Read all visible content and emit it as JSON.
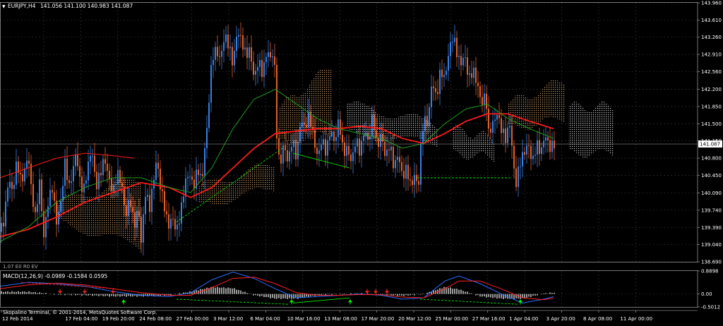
{
  "header": {
    "symbol": "EURJPY,H4",
    "ohlc": "141.056 141.100 140.983 141.087"
  },
  "colors": {
    "background": "#000000",
    "grid": "#3a3a3a",
    "axis": "#c0c0c0",
    "bull": "#3b7fe0",
    "bear": "#e0602a",
    "ma_fast": "#1e9e1e",
    "ma_slow": "#ff1a1a",
    "cloud_a": "#e8b07a",
    "cloud_b": "#e6e6e6",
    "macd_line": "#2a6fff",
    "signal_line": "#ff2020",
    "histogram": "#ffffff",
    "div_up": "#00ff00",
    "div_down": "#ff2020",
    "price_tag": "#ffffff"
  },
  "main_panel": {
    "corner_label": "1.07 E0 R0 EV",
    "price_tag": "141.087"
  },
  "macd_panel": {
    "label": "MACD(12,26,9) -0.0989 -0.1584 0.0595",
    "ticks": [
      "0.8898",
      "0.00",
      "-0.5012"
    ]
  },
  "footer": {
    "copyright": "Skopalino Terminal, © 2001-2014, MetaQuotes Software Corp."
  },
  "chart_data": {
    "type": "candlestick",
    "symbol": "EURJPY",
    "timeframe": "H4",
    "ylim": [
      138.69,
      143.96
    ],
    "y_ticks": [
      "143.960",
      "143.610",
      "143.260",
      "142.910",
      "142.560",
      "142.200",
      "141.850",
      "141.500",
      "141.150",
      "140.800",
      "140.450",
      "140.090",
      "139.740",
      "139.390",
      "139.040",
      "138.690"
    ],
    "x_ticks": [
      "12 Feb 2014",
      "17 Feb 04:00",
      "19 Feb 20:00",
      "24 Feb 08:00",
      "27 Feb 00:00",
      "3 Mar 12:00",
      "6 Mar 04:00",
      "10 Mar 16:00",
      "13 Mar 08:00",
      "17 Mar 20:00",
      "20 Mar 12:00",
      "25 Mar 00:00",
      "27 Mar 16:00",
      "1 Apr 04:00",
      "3 Apr 20:00",
      "8 Apr 08:00",
      "11 Apr 00:00"
    ],
    "last_price": 141.087,
    "close_path": [
      [
        0,
        139.3
      ],
      [
        6,
        139.55
      ],
      [
        12,
        140.4
      ],
      [
        18,
        140.1
      ],
      [
        24,
        140.75
      ],
      [
        30,
        140.3
      ],
      [
        36,
        140.6
      ],
      [
        40,
        140.9
      ],
      [
        44,
        140.2
      ],
      [
        50,
        139.6
      ],
      [
        56,
        140.3
      ],
      [
        62,
        139.2
      ],
      [
        68,
        139.9
      ],
      [
        74,
        140.2
      ],
      [
        80,
        139.5
      ],
      [
        86,
        139.9
      ],
      [
        92,
        140.7
      ],
      [
        98,
        140.2
      ],
      [
        104,
        140.6
      ],
      [
        108,
        140.95
      ],
      [
        112,
        140.4
      ],
      [
        118,
        140.1
      ],
      [
        124,
        140.6
      ],
      [
        130,
        141.0
      ],
      [
        136,
        140.2
      ],
      [
        142,
        140.5
      ],
      [
        148,
        140.8
      ],
      [
        154,
        140.4
      ],
      [
        160,
        140.1
      ],
      [
        166,
        140.5
      ],
      [
        172,
        140.3
      ],
      [
        178,
        139.6
      ],
      [
        184,
        140.0
      ],
      [
        190,
        139.4
      ],
      [
        196,
        139.8
      ],
      [
        200,
        139.1
      ],
      [
        206,
        140.1
      ],
      [
        212,
        139.8
      ],
      [
        218,
        140.4
      ],
      [
        222,
        140.8
      ],
      [
        226,
        140.3
      ],
      [
        232,
        139.9
      ],
      [
        238,
        139.4
      ],
      [
        244,
        139.6
      ],
      [
        250,
        139.3
      ],
      [
        256,
        139.7
      ],
      [
        262,
        140.3
      ],
      [
        268,
        140.5
      ],
      [
        274,
        140.2
      ],
      [
        280,
        140.6
      ],
      [
        286,
        140.3
      ],
      [
        290,
        141.0
      ],
      [
        294,
        141.5
      ],
      [
        298,
        142.5
      ],
      [
        302,
        142.9
      ],
      [
        306,
        143.0
      ],
      [
        312,
        142.8
      ],
      [
        318,
        143.3
      ],
      [
        324,
        143.1
      ],
      [
        330,
        142.7
      ],
      [
        336,
        143.4
      ],
      [
        342,
        143.2
      ],
      [
        348,
        142.9
      ],
      [
        354,
        143.0
      ],
      [
        360,
        142.4
      ],
      [
        366,
        142.8
      ],
      [
        372,
        142.5
      ],
      [
        378,
        143.0
      ],
      [
        384,
        142.8
      ],
      [
        388,
        143.05
      ],
      [
        392,
        141.3
      ],
      [
        396,
        140.6
      ],
      [
        402,
        141.1
      ],
      [
        408,
        140.7
      ],
      [
        414,
        141.2
      ],
      [
        420,
        140.8
      ],
      [
        426,
        141.6
      ],
      [
        432,
        141.4
      ],
      [
        438,
        141.7
      ],
      [
        444,
        141.2
      ],
      [
        450,
        140.8
      ],
      [
        456,
        141.2
      ],
      [
        462,
        140.9
      ],
      [
        468,
        141.4
      ],
      [
        474,
        141.1
      ],
      [
        480,
        141.6
      ],
      [
        486,
        140.9
      ],
      [
        492,
        141.0
      ],
      [
        498,
        140.7
      ],
      [
        504,
        141.2
      ],
      [
        510,
        140.9
      ],
      [
        516,
        141.4
      ],
      [
        522,
        141.1
      ],
      [
        528,
        141.7
      ],
      [
        534,
        141.0
      ],
      [
        540,
        141.3
      ],
      [
        546,
        140.8
      ],
      [
        552,
        141.1
      ],
      [
        558,
        140.6
      ],
      [
        564,
        140.9
      ],
      [
        570,
        140.4
      ],
      [
        576,
        140.6
      ],
      [
        582,
        140.2
      ],
      [
        588,
        140.5
      ],
      [
        592,
        140.1
      ],
      [
        596,
        141.0
      ],
      [
        600,
        141.6
      ],
      [
        606,
        141.5
      ],
      [
        612,
        142.4
      ],
      [
        618,
        142.0
      ],
      [
        624,
        142.6
      ],
      [
        630,
        142.4
      ],
      [
        636,
        143.0
      ],
      [
        642,
        143.3
      ],
      [
        646,
        143.0
      ],
      [
        652,
        142.7
      ],
      [
        658,
        142.9
      ],
      [
        664,
        142.4
      ],
      [
        670,
        142.6
      ],
      [
        676,
        142.3
      ],
      [
        682,
        141.9
      ],
      [
        688,
        142.1
      ],
      [
        692,
        141.3
      ],
      [
        698,
        141.5
      ],
      [
        704,
        141.7
      ],
      [
        710,
        141.4
      ],
      [
        716,
        141.2
      ],
      [
        722,
        141.5
      ],
      [
        726,
        140.9
      ],
      [
        730,
        140.2
      ],
      [
        736,
        140.7
      ],
      [
        742,
        140.9
      ],
      [
        748,
        141.1
      ],
      [
        754,
        140.7
      ],
      [
        760,
        141.1
      ],
      [
        766,
        140.9
      ],
      [
        772,
        141.3
      ],
      [
        778,
        141.0
      ],
      [
        784,
        141.087
      ]
    ],
    "ma_fast": [
      [
        0,
        139.1
      ],
      [
        40,
        139.4
      ],
      [
        80,
        139.9
      ],
      [
        120,
        140.2
      ],
      [
        160,
        140.4
      ],
      [
        200,
        140.4
      ],
      [
        240,
        140.2
      ],
      [
        270,
        140.1
      ],
      [
        300,
        140.6
      ],
      [
        330,
        141.4
      ],
      [
        360,
        142.0
      ],
      [
        390,
        142.2
      ],
      [
        420,
        141.9
      ],
      [
        450,
        141.6
      ],
      [
        480,
        141.4
      ],
      [
        510,
        141.3
      ],
      [
        540,
        141.2
      ],
      [
        570,
        141.0
      ],
      [
        600,
        141.1
      ],
      [
        630,
        141.5
      ],
      [
        660,
        141.8
      ],
      [
        690,
        141.9
      ],
      [
        720,
        141.6
      ],
      [
        750,
        141.4
      ],
      [
        784,
        141.2
      ]
    ],
    "ma_slow": [
      [
        0,
        139.2
      ],
      [
        40,
        139.35
      ],
      [
        80,
        139.6
      ],
      [
        120,
        139.9
      ],
      [
        160,
        140.1
      ],
      [
        200,
        140.3
      ],
      [
        240,
        140.2
      ],
      [
        270,
        140.0
      ],
      [
        300,
        140.2
      ],
      [
        330,
        140.6
      ],
      [
        360,
        141.0
      ],
      [
        390,
        141.3
      ],
      [
        420,
        141.35
      ],
      [
        450,
        141.4
      ],
      [
        480,
        141.4
      ],
      [
        510,
        141.45
      ],
      [
        540,
        141.4
      ],
      [
        570,
        141.2
      ],
      [
        600,
        141.1
      ],
      [
        630,
        141.3
      ],
      [
        660,
        141.55
      ],
      [
        690,
        141.7
      ],
      [
        720,
        141.7
      ],
      [
        750,
        141.55
      ],
      [
        784,
        141.4
      ]
    ],
    "ma_long": [
      [
        0,
        140.4
      ],
      [
        40,
        140.6
      ],
      [
        80,
        140.8
      ],
      [
        120,
        140.9
      ],
      [
        160,
        140.85
      ],
      [
        190,
        140.8
      ]
    ],
    "cloud_a": [
      {
        "x": [
          80,
          200
        ],
        "top": [
          139.9,
          140.4
        ],
        "bot": [
          139.5,
          139.0
        ]
      },
      {
        "x": [
          280,
          390
        ],
        "top": [
          140.2,
          140.7
        ],
        "bot": [
          139.8,
          140.2
        ]
      },
      {
        "x": [
          395,
          470
        ],
        "top": [
          141.8,
          142.7
        ],
        "bot": [
          141.1,
          141.3
        ]
      },
      {
        "x": [
          720,
          800
        ],
        "top": [
          141.9,
          142.4
        ],
        "bot": [
          141.4,
          141.6
        ]
      }
    ],
    "cloud_b": [
      {
        "x": [
          490,
          620
        ],
        "top": [
          141.9,
          141.5
        ],
        "bot": [
          141.3,
          141.1
        ]
      },
      {
        "x": [
          640,
          700
        ],
        "top": [
          141.4,
          141.2
        ],
        "bot": [
          140.9,
          140.8
        ]
      },
      {
        "x": [
          805,
          870
        ],
        "top": [
          141.85,
          141.85
        ],
        "bot": [
          140.9,
          140.9
        ]
      }
    ],
    "divergence_lines": [
      {
        "color": "up",
        "from": [
          250,
          139.5
        ],
        "to": [
          400,
          141.0
        ],
        "dashed": true
      },
      {
        "color": "up",
        "from": [
          415,
          140.9
        ],
        "to": [
          495,
          140.6
        ],
        "dashed": false
      },
      {
        "color": "up",
        "from": [
          590,
          140.4
        ],
        "to": [
          725,
          140.4
        ],
        "dashed": true
      }
    ],
    "macd": {
      "ylim": [
        -0.5012,
        0.8898
      ],
      "zero": 0.0,
      "macd_line": [
        [
          0,
          0.3
        ],
        [
          40,
          0.45
        ],
        [
          80,
          0.4
        ],
        [
          120,
          0.3
        ],
        [
          160,
          0.1
        ],
        [
          200,
          -0.05
        ],
        [
          240,
          -0.1
        ],
        [
          270,
          0.05
        ],
        [
          300,
          0.55
        ],
        [
          330,
          0.85
        ],
        [
          360,
          0.6
        ],
        [
          390,
          0.2
        ],
        [
          420,
          -0.15
        ],
        [
          450,
          -0.1
        ],
        [
          480,
          -0.05
        ],
        [
          510,
          0.0
        ],
        [
          540,
          -0.05
        ],
        [
          570,
          -0.2
        ],
        [
          600,
          -0.15
        ],
        [
          630,
          0.5
        ],
        [
          650,
          0.7
        ],
        [
          680,
          0.4
        ],
        [
          710,
          0.0
        ],
        [
          740,
          -0.35
        ],
        [
          770,
          -0.2
        ],
        [
          784,
          -0.1
        ]
      ],
      "signal_line": [
        [
          0,
          0.2
        ],
        [
          40,
          0.35
        ],
        [
          80,
          0.42
        ],
        [
          120,
          0.35
        ],
        [
          160,
          0.2
        ],
        [
          200,
          0.05
        ],
        [
          240,
          -0.05
        ],
        [
          270,
          -0.05
        ],
        [
          300,
          0.25
        ],
        [
          330,
          0.6
        ],
        [
          360,
          0.65
        ],
        [
          390,
          0.4
        ],
        [
          420,
          0.05
        ],
        [
          450,
          -0.05
        ],
        [
          480,
          -0.05
        ],
        [
          510,
          -0.02
        ],
        [
          540,
          -0.03
        ],
        [
          570,
          -0.12
        ],
        [
          600,
          -0.15
        ],
        [
          630,
          0.2
        ],
        [
          650,
          0.5
        ],
        [
          680,
          0.5
        ],
        [
          710,
          0.2
        ],
        [
          740,
          -0.15
        ],
        [
          770,
          -0.22
        ],
        [
          784,
          -0.16
        ]
      ],
      "divergence": [
        {
          "color": "down",
          "from": [
            30,
            0.45
          ],
          "to": [
            165,
            0.2
          ],
          "dashed": true
        },
        {
          "color": "up",
          "from": [
            250,
            -0.2
          ],
          "to": [
            410,
            -0.4
          ],
          "dashed": true
        },
        {
          "color": "up",
          "from": [
            415,
            -0.35
          ],
          "to": [
            495,
            -0.15
          ],
          "dashed": false
        },
        {
          "color": "up",
          "from": [
            595,
            -0.2
          ],
          "to": [
            735,
            -0.4
          ],
          "dashed": true
        }
      ],
      "arrows": [
        {
          "x": 85,
          "dir": "down",
          "color": "down"
        },
        {
          "x": 120,
          "dir": "down",
          "color": "down"
        },
        {
          "x": 160,
          "dir": "down",
          "color": "down"
        },
        {
          "x": 175,
          "dir": "up",
          "color": "up"
        },
        {
          "x": 413,
          "dir": "up",
          "color": "up"
        },
        {
          "x": 496,
          "dir": "up",
          "color": "up"
        },
        {
          "x": 520,
          "dir": "down",
          "color": "down"
        },
        {
          "x": 532,
          "dir": "down",
          "color": "down"
        },
        {
          "x": 548,
          "dir": "down",
          "color": "down"
        },
        {
          "x": 737,
          "dir": "up",
          "color": "up"
        }
      ]
    }
  }
}
